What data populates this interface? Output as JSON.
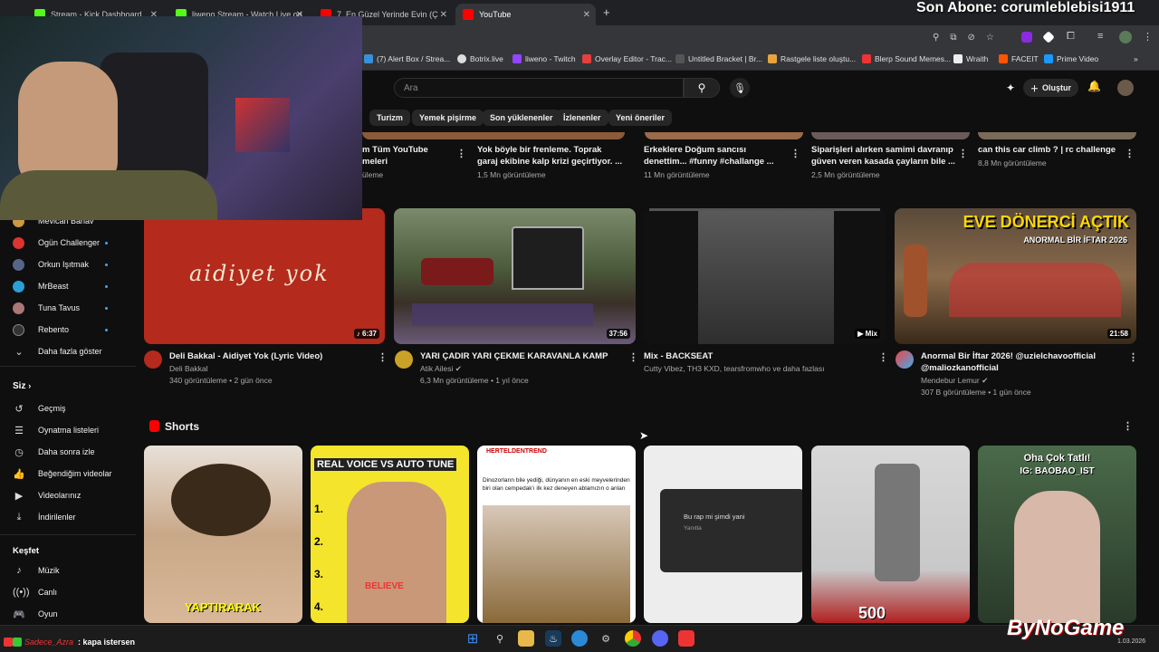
{
  "browser": {
    "tabs": [
      {
        "label": "Stream - Kick Dashboard",
        "color": "#53fc18"
      },
      {
        "label": "liweno Stream - Watch Live on",
        "color": "#53fc18"
      },
      {
        "label": "7. En Güzel Yerinde Evin (Ç",
        "color": "#ff0000"
      },
      {
        "label": "YouTube",
        "color": "#ff0000"
      }
    ],
    "new_tab": "+",
    "bookmarks": [
      "(7) Alert Box / Strea...",
      "Botrix.live",
      "liweno - Twitch",
      "Overlay Editor - Trac...",
      "Untitled Bracket | Br...",
      "Rastgele liste oluştu...",
      "Blerp Sound Memes...",
      "Wraith",
      "FACEIT",
      "Prime Video"
    ]
  },
  "stream_overlay": {
    "subscriber_text": "Son Abone: corumleblebisi1911",
    "chat_user": "Sadece_Azra",
    "chat_message": ": kapa istersen",
    "brand": "ByNoGame",
    "date": "1.03.2026"
  },
  "youtube": {
    "search_placeholder": "Ara",
    "create_label": "Oluştur",
    "chips": [
      "Turizm",
      "Yemek pişirme",
      "Son yüklenenler",
      "İzlenenler",
      "Yeni öneriler"
    ],
    "top_row": [
      {
        "title_1": "m Tüm YouTube",
        "title_2": "meleri",
        "meta": "üleme"
      },
      {
        "title_1": "Yok böyle bir frenleme. Toprak",
        "title_2": "garaj ekibine kalp krizi geçirtiyor. ...",
        "meta": "1,5 Mn görüntüleme"
      },
      {
        "title_1": "Erkeklere Doğum sancısı",
        "title_2": "denettim... #funny #challange ...",
        "meta": "11 Mn görüntüleme"
      },
      {
        "title_1": "Siparişleri alırken samimi davranıp",
        "title_2": "güven veren kasada çayların bile ...",
        "meta": "2,5 Mn görüntüleme"
      },
      {
        "title_1": "can this car climb ? | rc challenge",
        "title_2": "",
        "meta": "8,8 Mn görüntüleme"
      }
    ],
    "sidebar": {
      "subscriptions": [
        "Mevlcan Bahav",
        "Ogün Challenger",
        "Orkun Işıtmak",
        "MrBeast",
        "Tuna Tavus",
        "Rebento"
      ],
      "show_more": "Daha fazla göster",
      "you_heading": "Siz",
      "you_items": [
        "Geçmiş",
        "Oynatma listeleri",
        "Daha sonra izle",
        "Beğendiğim videolar",
        "Videolarınız",
        "İndirilenler"
      ],
      "explore_heading": "Keşfet",
      "explore_items": [
        "Müzik",
        "Canlı",
        "Oyun"
      ]
    },
    "videos": [
      {
        "title_1": "Deli Bakkal - Aidiyet Yok (Lyric Video)",
        "title_2": "",
        "channel": "Deli Bakkal",
        "meta": "340 görüntüleme • 2 gün önce",
        "duration": "♪ 6:37",
        "thumb_text": "aidiyet yok"
      },
      {
        "title_1": "YARI ÇADIR YARI ÇEKME KARAVANLA KAMP",
        "title_2": "",
        "channel": "Atik Ailesi ✔",
        "meta": "6,3 Mn görüntüleme • 1 yıl önce",
        "duration": "37:56",
        "thumb_text": ""
      },
      {
        "title_1": "Mix - BACKSEAT",
        "title_2": "",
        "channel": "Cutty Vibez, TH3 KXD, tearsfromwho ve daha fazlası",
        "meta": "",
        "duration": "▶ Mix",
        "thumb_text": ""
      },
      {
        "title_1": "Anormal Bir İftar 2026! @uzielchavoofficial",
        "title_2": "@maliozkanofficial",
        "channel": "Mendebur Lemur ✔",
        "meta": "307 B görüntüleme • 1 gün önce",
        "duration": "21:58",
        "thumb_text": "EVE DÖNERCİ AÇTIK",
        "thumb_sub": "ANORMAL BİR İFTAR 2026"
      }
    ],
    "shorts_heading": "Shorts",
    "shorts": [
      {
        "overlay": "YAPTIRARAK"
      },
      {
        "overlay": "REAL VOICE VS AUTO TUNE",
        "list": [
          "1.",
          "2.",
          "3.",
          "4."
        ],
        "shirt": "BELIEVE"
      },
      {
        "overlay": "Dinozorların bile yediği, dünyanın en eski meyvelerinden biri olan cempedak'ı ilk kez deneyen ablamızın o anları",
        "brand": "HERTELDENTREND"
      },
      {
        "overlay": "Bu rap mi şimdi yani",
        "sub": "Yanıtla"
      },
      {
        "overlay": "500"
      },
      {
        "overlay": "Oha Çok Tatlı!",
        "sub": "IG: BAOBAO_IST"
      }
    ]
  },
  "colors": {
    "youtube_red": "#ff0000",
    "kick_green": "#53fc18",
    "link_blue": "#3ea6ff"
  }
}
